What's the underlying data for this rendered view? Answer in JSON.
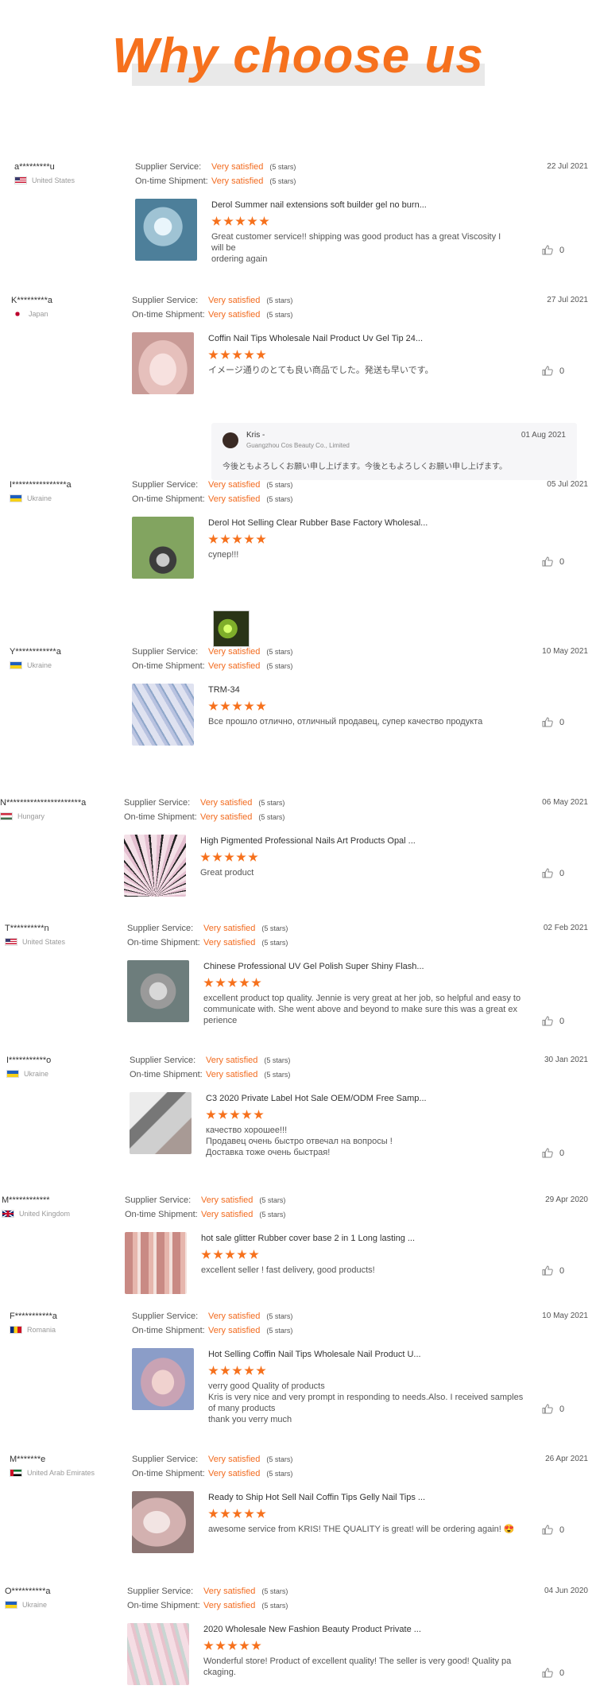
{
  "banner": {
    "title": "Why choose us"
  },
  "labels": {
    "supplier_service": "Supplier Service:",
    "ontime_shipment": "On-time Shipment:"
  },
  "colors": {
    "accent": "#f6711d",
    "satisfied_text": "#f26b1f"
  },
  "reviews": [
    {
      "user": "a*********u",
      "country": "United States",
      "flag": "us-flag-icon",
      "service": "Very satisfied",
      "service_stars": "(5 stars)",
      "shipment": "Very satisfied",
      "shipment_stars": "(5 stars)",
      "date": "22 Jul 2021",
      "product": "Derol Summer nail extensions soft builder gel no burn...",
      "rating": 5,
      "text": [
        "Great customer service!! shipping was good product has a great Viscosity I will be",
        "ordering again"
      ],
      "likes": "0"
    },
    {
      "user": "K*********a",
      "country": "Japan",
      "flag": "japan-flag-icon",
      "service": "Very satisfied",
      "service_stars": "(5 stars)",
      "shipment": "Very satisfied",
      "shipment_stars": "(5 stars)",
      "date": "27 Jul 2021",
      "product": "Coffin Nail Tips Wholesale Nail Product Uv Gel Tip 24...",
      "rating": 5,
      "text": [
        "イメージ通りのとても良い商品でした。発送も早いです。"
      ],
      "likes": "0",
      "reply": {
        "name": "Kris -",
        "company": "Guangzhou Cos Beauty Co., Limited",
        "date": "01 Aug 2021",
        "text": "今後ともよろしくお願い申し上げます。今後ともよろしくお願い申し上げます。"
      }
    },
    {
      "user": "I****************a",
      "country": "Ukraine",
      "flag": "ukraine-flag-icon",
      "service": "Very satisfied",
      "service_stars": "(5 stars)",
      "shipment": "Very satisfied",
      "shipment_stars": "(5 stars)",
      "date": "05 Jul 2021",
      "product": "Derol Hot Selling Clear Rubber Base Factory Wholesal...",
      "rating": 5,
      "text": [
        "супер!!!"
      ],
      "likes": "0"
    },
    {
      "user": "Y************a",
      "country": "Ukraine",
      "flag": "ukraine-flag-icon",
      "service": "Very satisfied",
      "service_stars": "(5 stars)",
      "shipment": "Very satisfied",
      "shipment_stars": "(5 stars)",
      "date": "10 May 2021",
      "product": "TRM-34",
      "rating": 5,
      "text": [
        "Все прошло отлично, отличный продавец, супер качество продукта"
      ],
      "likes": "0"
    },
    {
      "user": "N**********************a",
      "country": "Hungary",
      "flag": "hungary-flag-icon",
      "service": "Very satisfied",
      "service_stars": "(5 stars)",
      "shipment": "Very satisfied",
      "shipment_stars": "(5 stars)",
      "date": "06 May 2021",
      "product": "High Pigmented Professional Nails Art Products Opal ...",
      "rating": 5,
      "text": [
        "Great product"
      ],
      "likes": "0"
    },
    {
      "user": "T**********n",
      "country": "United States",
      "flag": "us-flag-icon",
      "service": "Very satisfied",
      "service_stars": "(5 stars)",
      "shipment": "Very satisfied",
      "shipment_stars": "(5 stars)",
      "date": "02 Feb 2021",
      "product": "Chinese Professional UV Gel Polish Super Shiny Flash...",
      "rating": 5,
      "text": [
        "excellent product top quality. Jennie is very great at her job, so helpful and easy to",
        "communicate with. She went above and beyond to make sure this was a great ex",
        "perience"
      ],
      "likes": "0"
    },
    {
      "user": "I***********o",
      "country": "Ukraine",
      "flag": "ukraine-flag-icon",
      "service": "Very satisfied",
      "service_stars": "(5 stars)",
      "shipment": "Very satisfied",
      "shipment_stars": "(5 stars)",
      "date": "30 Jan 2021",
      "product": "C3 2020 Private Label Hot Sale OEM/ODM Free Samp...",
      "rating": 5,
      "text": [
        "качество хорошее!!!",
        "Продавец очень быстро отвечал на вопросы !",
        "Доставка тоже очень быстрая!"
      ],
      "likes": "0"
    },
    {
      "user": "M************",
      "country": "United Kingdom",
      "flag": "uk-flag-icon",
      "service": "Very satisfied",
      "service_stars": "(5 stars)",
      "shipment": "Very satisfied",
      "shipment_stars": "(5 stars)",
      "date": "29 Apr 2020",
      "product": "hot sale glitter Rubber cover base 2 in 1 Long lasting ...",
      "rating": 5,
      "text": [
        "excellent seller ! fast delivery, good products!"
      ],
      "likes": "0"
    },
    {
      "user": "F***********a",
      "country": "Romania",
      "flag": "romania-flag-icon",
      "service": "Very satisfied",
      "service_stars": "(5 stars)",
      "shipment": "Very satisfied",
      "shipment_stars": "(5 stars)",
      "date": "10 May 2021",
      "product": "Hot Selling Coffin Nail Tips Wholesale Nail Product U...",
      "rating": 5,
      "text": [
        "verry good Quality of products",
        "Kris is very nice and very prompt in responding to needs.Also. I received samples",
        "of many products",
        "thank you verry much"
      ],
      "likes": "0"
    },
    {
      "user": "M*******e",
      "country": "United Arab Emirates",
      "flag": "uae-flag-icon",
      "service": "Very satisfied",
      "service_stars": "(5 stars)",
      "shipment": "Very satisfied",
      "shipment_stars": "(5 stars)",
      "date": "26 Apr 2021",
      "product": "Ready to Ship Hot Sell Nail Coffin Tips Gelly Nail Tips ...",
      "rating": 5,
      "text": [
        "awesome service from KRIS!  THE QUALITY is great! will be ordering again! 😍"
      ],
      "likes": "0"
    },
    {
      "user": "O**********a",
      "country": "Ukraine",
      "flag": "ukraine-flag-icon",
      "service": "Very satisfied",
      "service_stars": "(5 stars)",
      "shipment": "Very satisfied",
      "shipment_stars": "(5 stars)",
      "date": "04 Jun 2020",
      "product": "2020 Wholesale New Fashion Beauty Product Private ...",
      "rating": 5,
      "text": [
        "Wonderful store!  Product of excellent quality!  The seller is very good!  Quality pa",
        "ckaging."
      ],
      "likes": "0"
    }
  ]
}
